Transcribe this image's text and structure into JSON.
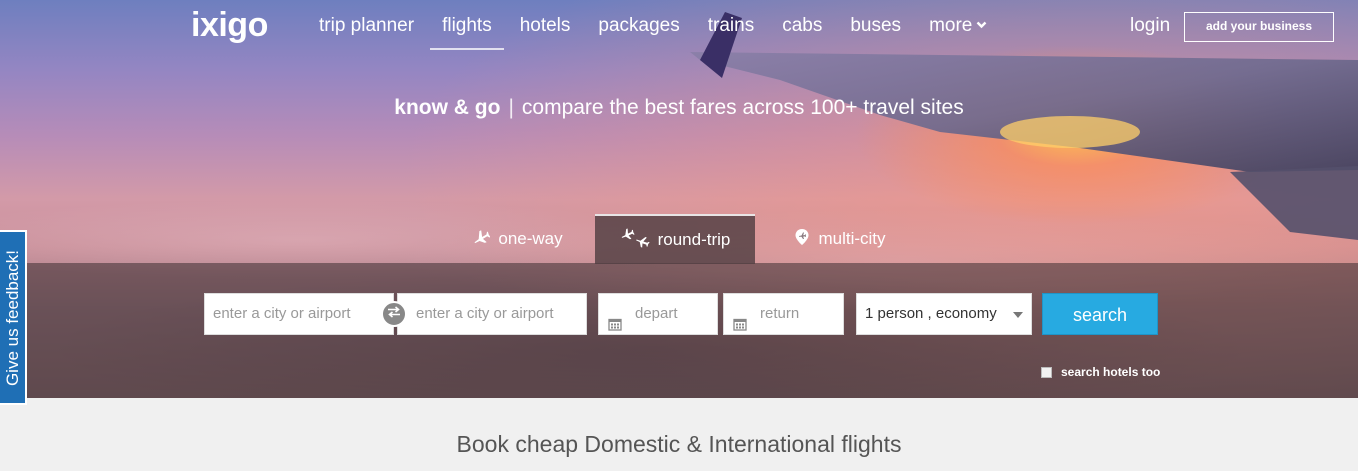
{
  "header": {
    "logo": "ixigo",
    "nav": [
      {
        "label": "trip planner"
      },
      {
        "label": "flights",
        "active": true
      },
      {
        "label": "hotels"
      },
      {
        "label": "packages"
      },
      {
        "label": "trains"
      },
      {
        "label": "cabs"
      },
      {
        "label": "buses"
      },
      {
        "label": "more",
        "icon": "chevron-down-icon"
      }
    ],
    "login": "login",
    "add_business": "add your business"
  },
  "hero": {
    "tagline_strong": "know & go",
    "tagline_sep": "|",
    "tagline_rest": "compare the best fares across 100+ travel sites"
  },
  "tabs": [
    {
      "label": "one-way",
      "icon": "plane-icon"
    },
    {
      "label": "round-trip",
      "icon": "round-trip-icon",
      "active": true
    },
    {
      "label": "multi-city",
      "icon": "multi-city-icon"
    }
  ],
  "search": {
    "from_placeholder": "enter a city or airport",
    "to_placeholder": "enter a city or airport",
    "depart_placeholder": "depart",
    "return_placeholder": "return",
    "passengers": "1 person , economy",
    "button": "search",
    "hotels_too": "search hotels too"
  },
  "feedback": "Give us feedback!",
  "section_title": "Book cheap Domestic & International flights",
  "colors": {
    "search_button": "#27aae1",
    "feedback_tab": "#1f6fb5"
  }
}
